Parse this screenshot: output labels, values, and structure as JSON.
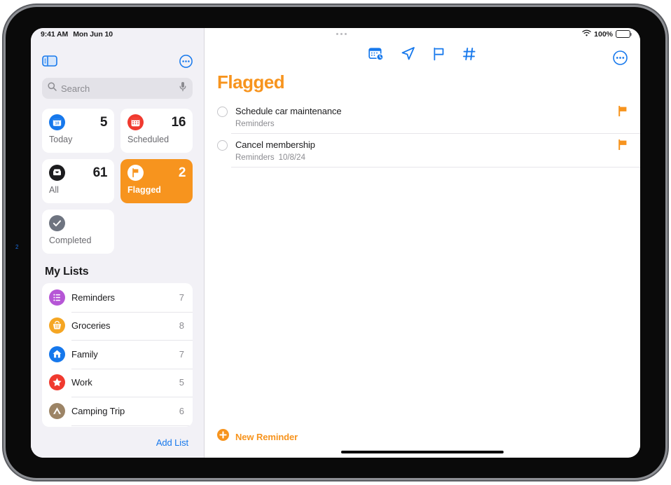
{
  "status_bar": {
    "time": "9:41 AM",
    "date": "Mon Jun 10",
    "wifi_icon": "wifi-icon",
    "battery_percent": "100%",
    "battery_icon": "battery-full-icon",
    "dots_icon": "multitasking-dots-icon"
  },
  "sidebar": {
    "toggle_icon": "sidebar-toggle-icon",
    "more_icon": "more-ellipsis-circle-icon",
    "search": {
      "placeholder": "Search",
      "search_icon": "search-icon",
      "mic_icon": "microphone-icon"
    },
    "smart_lists": [
      {
        "label": "Today",
        "count": "5",
        "icon": "calendar-day-icon",
        "color": "#1678ec",
        "selected": false
      },
      {
        "label": "Scheduled",
        "count": "16",
        "icon": "calendar-icon",
        "color": "#f03a2f",
        "selected": false
      },
      {
        "label": "All",
        "count": "61",
        "icon": "inbox-tray-icon",
        "color": "#1c1c1e",
        "selected": false
      },
      {
        "label": "Flagged",
        "count": "2",
        "icon": "flag-icon",
        "color": "#f7941e",
        "selected": true
      },
      {
        "label": "Completed",
        "count": "",
        "icon": "checkmark-circle-icon",
        "color": "#6e7480",
        "selected": false
      }
    ],
    "my_lists_header": "My Lists",
    "lists": [
      {
        "name": "Reminders",
        "count": "7",
        "icon": "bulleted-list-icon",
        "color": "#b656d6"
      },
      {
        "name": "Groceries",
        "count": "8",
        "icon": "basket-icon",
        "color": "#f5a623"
      },
      {
        "name": "Family",
        "count": "7",
        "icon": "house-icon",
        "color": "#1678ec"
      },
      {
        "name": "Work",
        "count": "5",
        "icon": "star-icon",
        "color": "#f03a2f"
      },
      {
        "name": "Camping Trip",
        "count": "6",
        "icon": "tent-icon",
        "color": "#9c8466"
      }
    ],
    "add_list_label": "Add List"
  },
  "detail": {
    "title": "Flagged",
    "accent_color": "#f7941e",
    "toolbar_icons": [
      "calendar-clock-icon",
      "location-arrow-icon",
      "flag-icon",
      "hashtag-icon"
    ],
    "more_icon": "more-ellipsis-circle-icon",
    "reminders": [
      {
        "title": "Schedule car maintenance",
        "list": "Reminders",
        "date": "",
        "flagged": true,
        "completed": false
      },
      {
        "title": "Cancel membership",
        "list": "Reminders",
        "date": "10/8/24",
        "flagged": true,
        "completed": false
      }
    ],
    "new_reminder_label": "New Reminder",
    "new_reminder_icon": "plus-circle-icon"
  },
  "bezel_marker": "2"
}
